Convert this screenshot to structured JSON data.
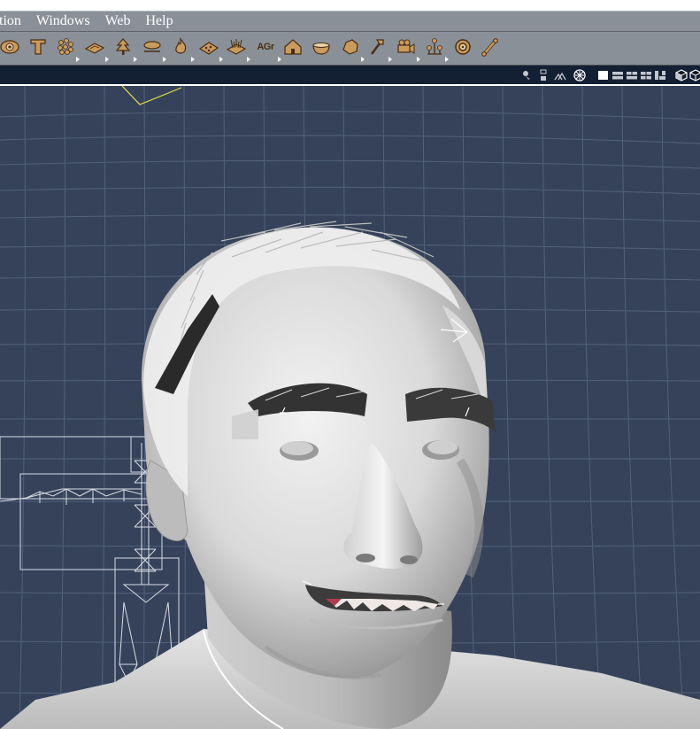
{
  "menubar": {
    "items": [
      {
        "label": "tion",
        "name": "menu-animation"
      },
      {
        "label": "Windows",
        "name": "menu-windows"
      },
      {
        "label": "Web",
        "name": "menu-web"
      },
      {
        "label": "Help",
        "name": "menu-help"
      }
    ]
  },
  "toolbar": {
    "agr_label": "AGr",
    "tools": [
      {
        "icon": "eye-icon"
      },
      {
        "icon": "text-tool-icon"
      },
      {
        "icon": "particle-icon"
      },
      {
        "icon": "plane-icon"
      },
      {
        "icon": "tree-icon"
      },
      {
        "icon": "cloud-icon"
      },
      {
        "icon": "fire-icon"
      },
      {
        "icon": "terrain-icon"
      },
      {
        "icon": "grass-icon"
      },
      {
        "icon": "agr-icon"
      },
      {
        "icon": "house-icon"
      },
      {
        "icon": "bowl-icon"
      },
      {
        "icon": "rock-icon"
      },
      {
        "icon": "hammer-icon"
      },
      {
        "icon": "camera-icon"
      },
      {
        "icon": "figure-group-icon"
      },
      {
        "icon": "target-icon"
      },
      {
        "icon": "bone-icon"
      }
    ]
  },
  "viewbar": {
    "icons": [
      "light-icon",
      "display-style-icon",
      "figure-display-icon",
      "render-icon",
      "layout-single-icon",
      "layout-two-icon",
      "layout-three-icon",
      "layout-four-icon",
      "layout-alt-icon",
      "cube-shade-icon",
      "cube-wire-icon"
    ]
  },
  "colors": {
    "chrome": "#8a9097",
    "viewbar": "#131f33",
    "viewport": "#35425a",
    "grid": "#5a6a84",
    "icon_wood": "#b98a4c"
  }
}
